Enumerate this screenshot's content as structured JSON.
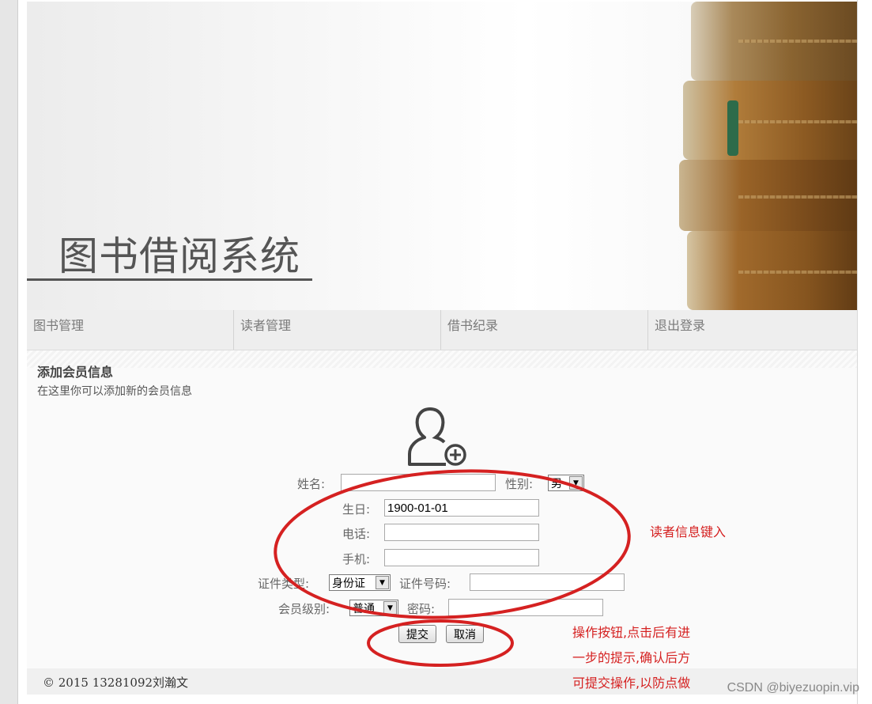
{
  "banner": {
    "title": "图书借阅系统"
  },
  "nav": {
    "items": [
      "图书管理",
      "读者管理",
      "借书纪录",
      "退出登录"
    ]
  },
  "page": {
    "heading": "添加会员信息",
    "subheading": "在这里你可以添加新的会员信息"
  },
  "form": {
    "name_label": "姓名:",
    "name_value": "",
    "gender_label": "性别:",
    "gender_value": "男",
    "birthday_label": "生日:",
    "birthday_value": "1900-01-01",
    "phone_label": "电话:",
    "phone_value": "",
    "mobile_label": "手机:",
    "mobile_value": "",
    "idtype_label": "证件类型:",
    "idtype_value": "身份证",
    "idnum_label": "证件号码:",
    "idnum_value": "",
    "level_label": "会员级别:",
    "level_value": "普通",
    "password_label": "密码:",
    "password_value": "",
    "submit_label": "提交",
    "cancel_label": "取消"
  },
  "footer": {
    "copyright": "© 2015  13281092刘瀚文"
  },
  "annotations": {
    "input_note": "读者信息键入",
    "button_note_line1": "操作按钮,点击后有进",
    "button_note_line2": "一步的提示,确认后方",
    "button_note_line3": "可提交操作,以防点做"
  },
  "watermark": "CSDN @biyezuopin.vip",
  "colors": {
    "annotation": "#d52121",
    "nav_bg": "#eeeeee"
  }
}
